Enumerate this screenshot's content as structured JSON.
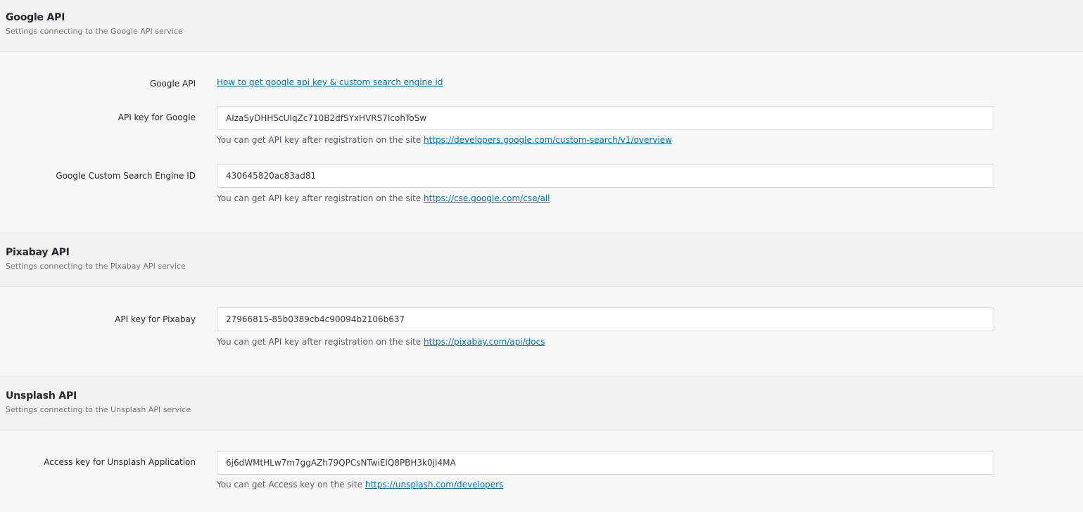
{
  "google": {
    "title": "Google API",
    "description": "Settings connecting to the Google API service",
    "guide_label": "Google API",
    "guide_link": "How to get google api key & custom search engine id",
    "api_key_label": "API key for Google",
    "api_key_value": "AIzaSyDHHScUIqZc710B2dfSYxHVRS7IcohToSw",
    "api_key_help": "You can get API key after registration on the site ",
    "api_key_help_link": "https://developers.google.com/custom-search/v1/overview",
    "cse_label": "Google Custom Search Engine ID",
    "cse_value": "430645820ac83ad81",
    "cse_help": "You can get API key after registration on the site ",
    "cse_help_link": "https://cse.google.com/cse/all"
  },
  "pixabay": {
    "title": "Pixabay API",
    "description": "Settings connecting to the Pixabay API service",
    "api_key_label": "API key for Pixabay",
    "api_key_value": "27966815-85b0389cb4c90094b2106b637",
    "api_key_help": "You can get API key after registration on the site ",
    "api_key_help_link": "https://pixabay.com/api/docs"
  },
  "unsplash": {
    "title": "Unsplash API",
    "description": "Settings connecting to the Unsplash API service",
    "access_key_label": "Access key for Unsplash Application",
    "access_key_value": "6j6dWMtHLw7m7ggAZh79QPCsNTwiElQ8PBH3k0jI4MA",
    "access_key_help": "You can get Access key on the site ",
    "access_key_help_link": "https://unsplash.com/developers"
  }
}
